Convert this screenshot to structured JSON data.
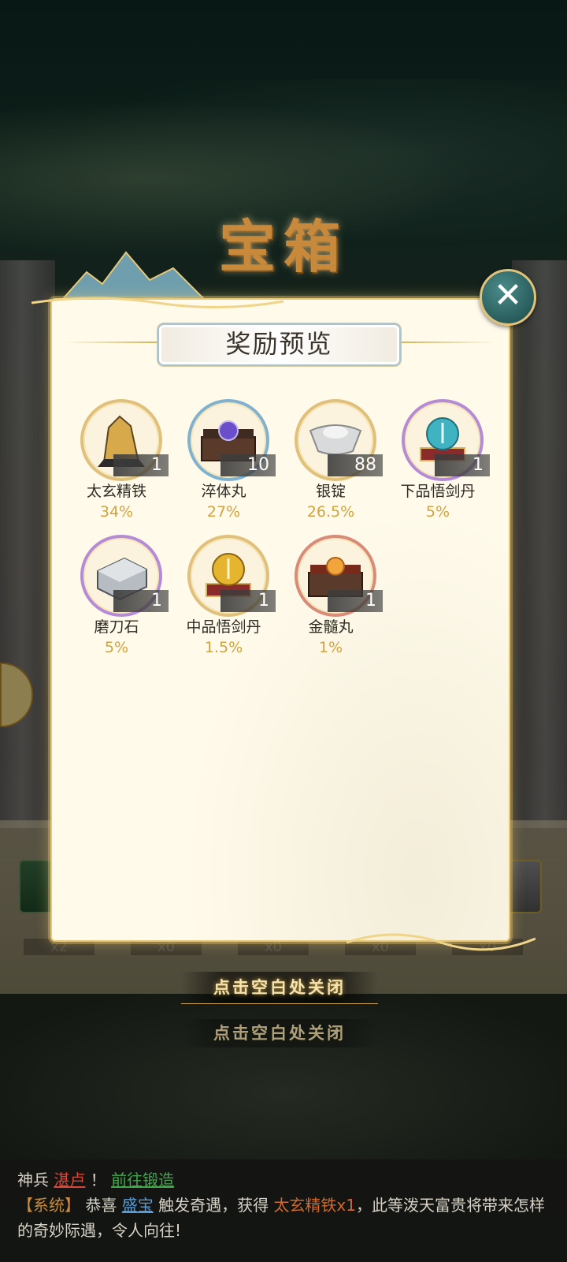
{
  "chest_title": "宝箱",
  "panel": {
    "heading": "奖励预览",
    "close_label": "✕"
  },
  "items": [
    {
      "name": "太玄精铁",
      "count": "1",
      "percent": "34%",
      "frame": "gold",
      "icon": "ore-icon"
    },
    {
      "name": "淬体丸",
      "count": "10",
      "percent": "27%",
      "frame": "blue",
      "icon": "pill-box-purple-icon"
    },
    {
      "name": "银锭",
      "count": "88",
      "percent": "26.5%",
      "frame": "gold",
      "icon": "silver-ingot-icon"
    },
    {
      "name": "下品悟剑丹",
      "count": "1",
      "percent": "5%",
      "frame": "purple",
      "icon": "sword-pill-cyan-icon"
    },
    {
      "name": "磨刀石",
      "count": "1",
      "percent": "5%",
      "frame": "purple",
      "icon": "whetstone-icon"
    },
    {
      "name": "中品悟剑丹",
      "count": "1",
      "percent": "1.5%",
      "frame": "gold",
      "icon": "sword-pill-gold-icon"
    },
    {
      "name": "金髓丸",
      "count": "1",
      "percent": "1%",
      "frame": "red",
      "icon": "pill-box-red-icon"
    }
  ],
  "chest_counts": [
    "x2",
    "x0",
    "x0",
    "x0",
    "x0"
  ],
  "hints": {
    "close_primary": "点击空白处关闭",
    "close_secondary": "点击空白处关闭"
  },
  "chat": {
    "line1_prefix": "神兵",
    "line1_player": "湛卢",
    "line1_bang": "！",
    "line1_link": "前往锻造",
    "line2_tag": "【系统】",
    "line2_text_a": "恭喜",
    "line2_player": "盛宝",
    "line2_text_b": "触发奇遇，获得",
    "line2_item": "太玄精铁x1",
    "line2_text_c": "，此等泼天富贵将带来怎样的奇妙际遇，令人向往!"
  },
  "colors": {
    "panel_bg": "#fffaea",
    "accent_gold": "#d2a23e",
    "close_teal": "#285d5c"
  }
}
